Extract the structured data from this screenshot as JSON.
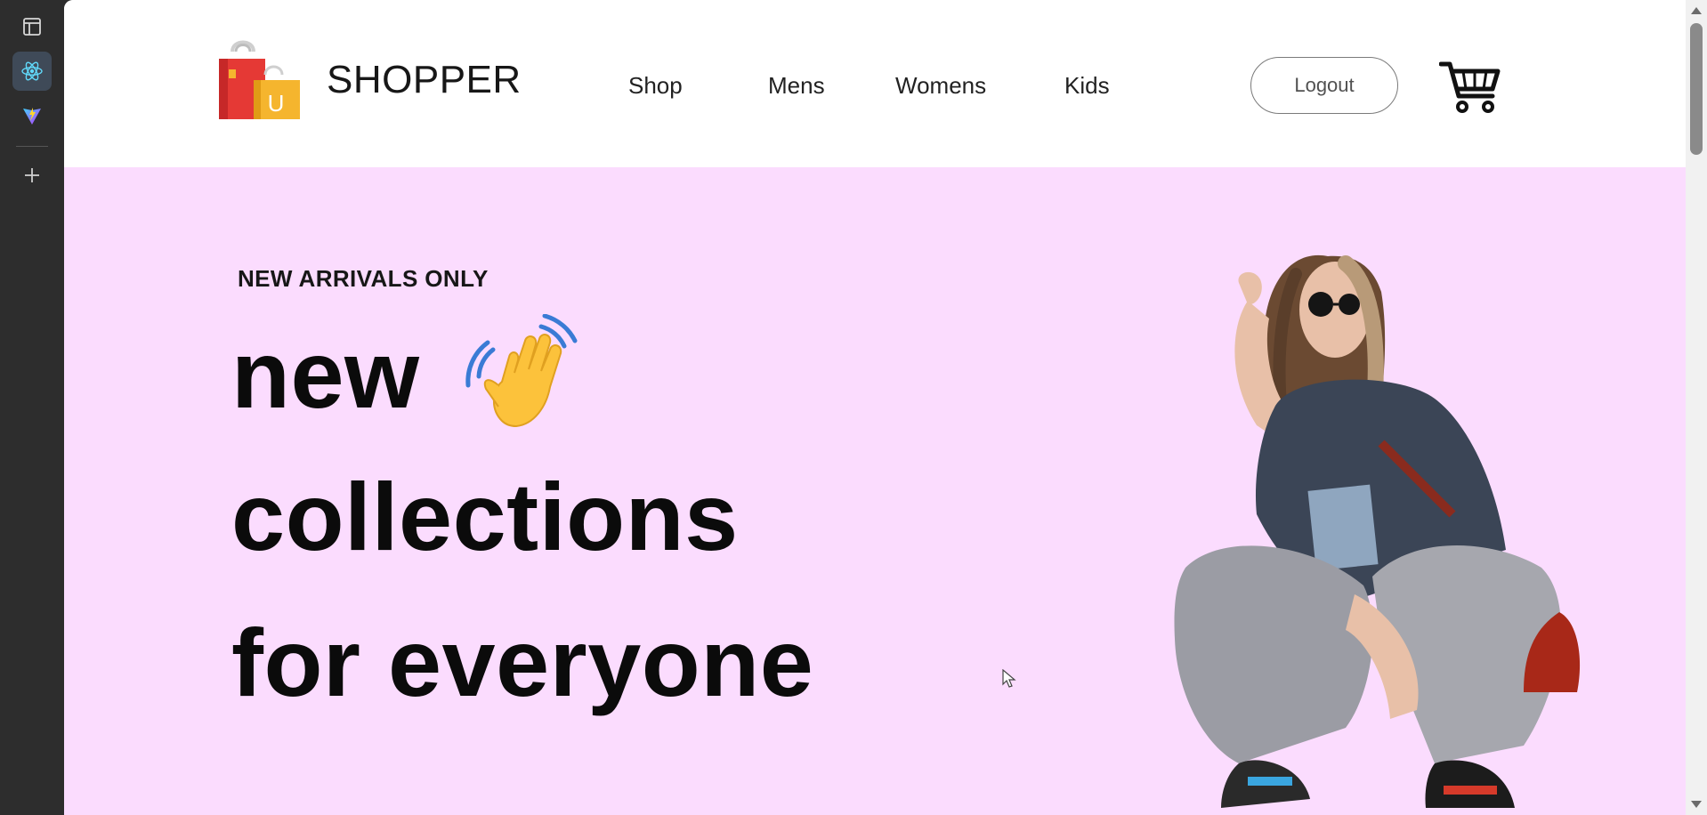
{
  "rail": {
    "items": [
      "panel-icon",
      "react-icon",
      "vite-icon",
      "plus-icon"
    ]
  },
  "navbar": {
    "logo_text": "SHOPPER",
    "menu": [
      {
        "label": "Shop"
      },
      {
        "label": "Mens"
      },
      {
        "label": "Womens"
      },
      {
        "label": "Kids"
      }
    ],
    "logout_label": "Logout",
    "cart_icon": "cart-icon"
  },
  "hero": {
    "tagline": "NEW ARRIVALS ONLY",
    "line1": "new",
    "line2": "collections",
    "line3": "for everyone",
    "wave_icon": "waving-hand-icon",
    "background": "#fbdcfe"
  },
  "colors": {
    "hero_bg": "#fbdcfe",
    "rail_bg": "#2d2d2d",
    "logo_bag_red": "#e53935",
    "logo_bag_yellow": "#f5b52e"
  }
}
